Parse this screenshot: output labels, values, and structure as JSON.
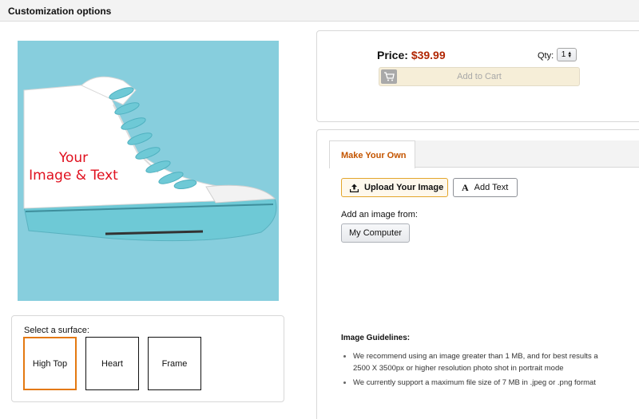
{
  "header": {
    "title": "Customization options"
  },
  "preview": {
    "background_color": "#87cedd",
    "overlay_text_line1": "Your",
    "overlay_text_line2": "Image & Text",
    "overlay_text_color": "#e0101e"
  },
  "surface": {
    "label": "Select a surface:",
    "options": [
      {
        "label": "High Top",
        "selected": true
      },
      {
        "label": "Heart",
        "selected": false
      },
      {
        "label": "Frame",
        "selected": false
      }
    ]
  },
  "purchase": {
    "price_label": "Price:",
    "price_value": "$39.99",
    "qty_label": "Qty:",
    "qty_value": "1",
    "cart_icon": "shopping-cart-icon",
    "add_to_cart_label": "Add to Cart"
  },
  "customize": {
    "tab_label": "Make Your Own",
    "upload_button_label": "Upload Your Image",
    "upload_icon": "upload-icon",
    "add_text_button_label": "Add Text",
    "add_text_icon": "text-a-icon",
    "add_from_label": "Add an image from:",
    "my_computer_button_label": "My Computer",
    "guidelines_title": "Image Guidelines:",
    "guidelines": [
      "We recommend using an image greater than 1 MB, and for best results a 2500 X 3500px or higher resolution photo shot in portrait mode",
      "We currently support a maximum file size of 7 MB in .jpeg or .png format"
    ]
  },
  "colors": {
    "accent_orange": "#e47911",
    "price_red": "#b12704",
    "tab_text": "#c45500"
  }
}
